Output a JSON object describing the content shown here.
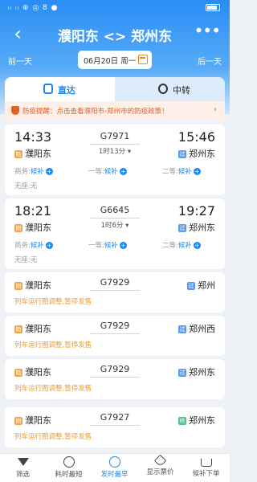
{
  "header": {
    "title": "濮阳东 <> 郑州东",
    "back_glyph": "‹",
    "more_glyph": "•••",
    "prev_day": "前一天",
    "next_day": "后一天",
    "date": "06月20日 周一"
  },
  "statusbar": {
    "left": "ᵢₗ ᵢₗ ⊕ ◎ 8 ●",
    "right": ""
  },
  "tabs": {
    "direct": "直达",
    "transfer": "中转"
  },
  "notice": {
    "text": "防疫提醒：点击查看濮阳市-郑州市的防疫政策！",
    "arrow": "›"
  },
  "trains_full": [
    {
      "dep_time": "14:33",
      "arr_time": "15:46",
      "number": "G7971",
      "duration": "1时13分 ▾",
      "from": "濮阳东",
      "to": "郑州东",
      "from_tag": "始",
      "to_tag": "过",
      "seats": [
        {
          "label": "商务:",
          "value": "候补"
        },
        {
          "label": "一等:",
          "value": "候补"
        },
        {
          "label": "二等:",
          "value": "候补"
        }
      ],
      "noseat": {
        "label": "无座:",
        "value": "无"
      }
    },
    {
      "dep_time": "18:21",
      "arr_time": "19:27",
      "number": "G6645",
      "duration": "1时6分 ▾",
      "from": "濮阳东",
      "to": "郑州东",
      "from_tag": "始",
      "to_tag": "过",
      "seats": [
        {
          "label": "商务:",
          "value": "候补"
        },
        {
          "label": "一等:",
          "value": "候补"
        },
        {
          "label": "二等:",
          "value": "候补"
        }
      ],
      "noseat": {
        "label": "无座:",
        "value": "无"
      }
    }
  ],
  "trains_stopped": [
    {
      "number": "G7929",
      "from": "濮阳东",
      "to": "郑州",
      "from_tag": "始",
      "to_tag": "过",
      "note": "列车运行图调整,暂停发售"
    },
    {
      "number": "G7929",
      "from": "濮阳东",
      "to": "郑州西",
      "from_tag": "始",
      "to_tag": "过",
      "note": "列车运行图调整,暂停发售"
    },
    {
      "number": "G7929",
      "from": "濮阳东",
      "to": "郑州东",
      "from_tag": "始",
      "to_tag": "过",
      "note": "列车运行图调整,暂停发售"
    },
    {
      "number": "G7927",
      "from": "濮阳东",
      "to": "郑州东",
      "from_tag": "始",
      "to_tag": "终",
      "note": "列车运行图调整,暂停发售"
    }
  ],
  "bottom_nav": [
    {
      "label": "筛选",
      "icon": "filter-icon"
    },
    {
      "label": "耗时最短",
      "icon": "clock-icon"
    },
    {
      "label": "发时最早",
      "icon": "clock-icon"
    },
    {
      "label": "显示票价",
      "icon": "price-tag-icon"
    },
    {
      "label": "候补下单",
      "icon": "cart-icon"
    }
  ],
  "colors": {
    "brand": "#1f86ee",
    "notice": "#e0612a",
    "stop_note": "#e79b35"
  }
}
